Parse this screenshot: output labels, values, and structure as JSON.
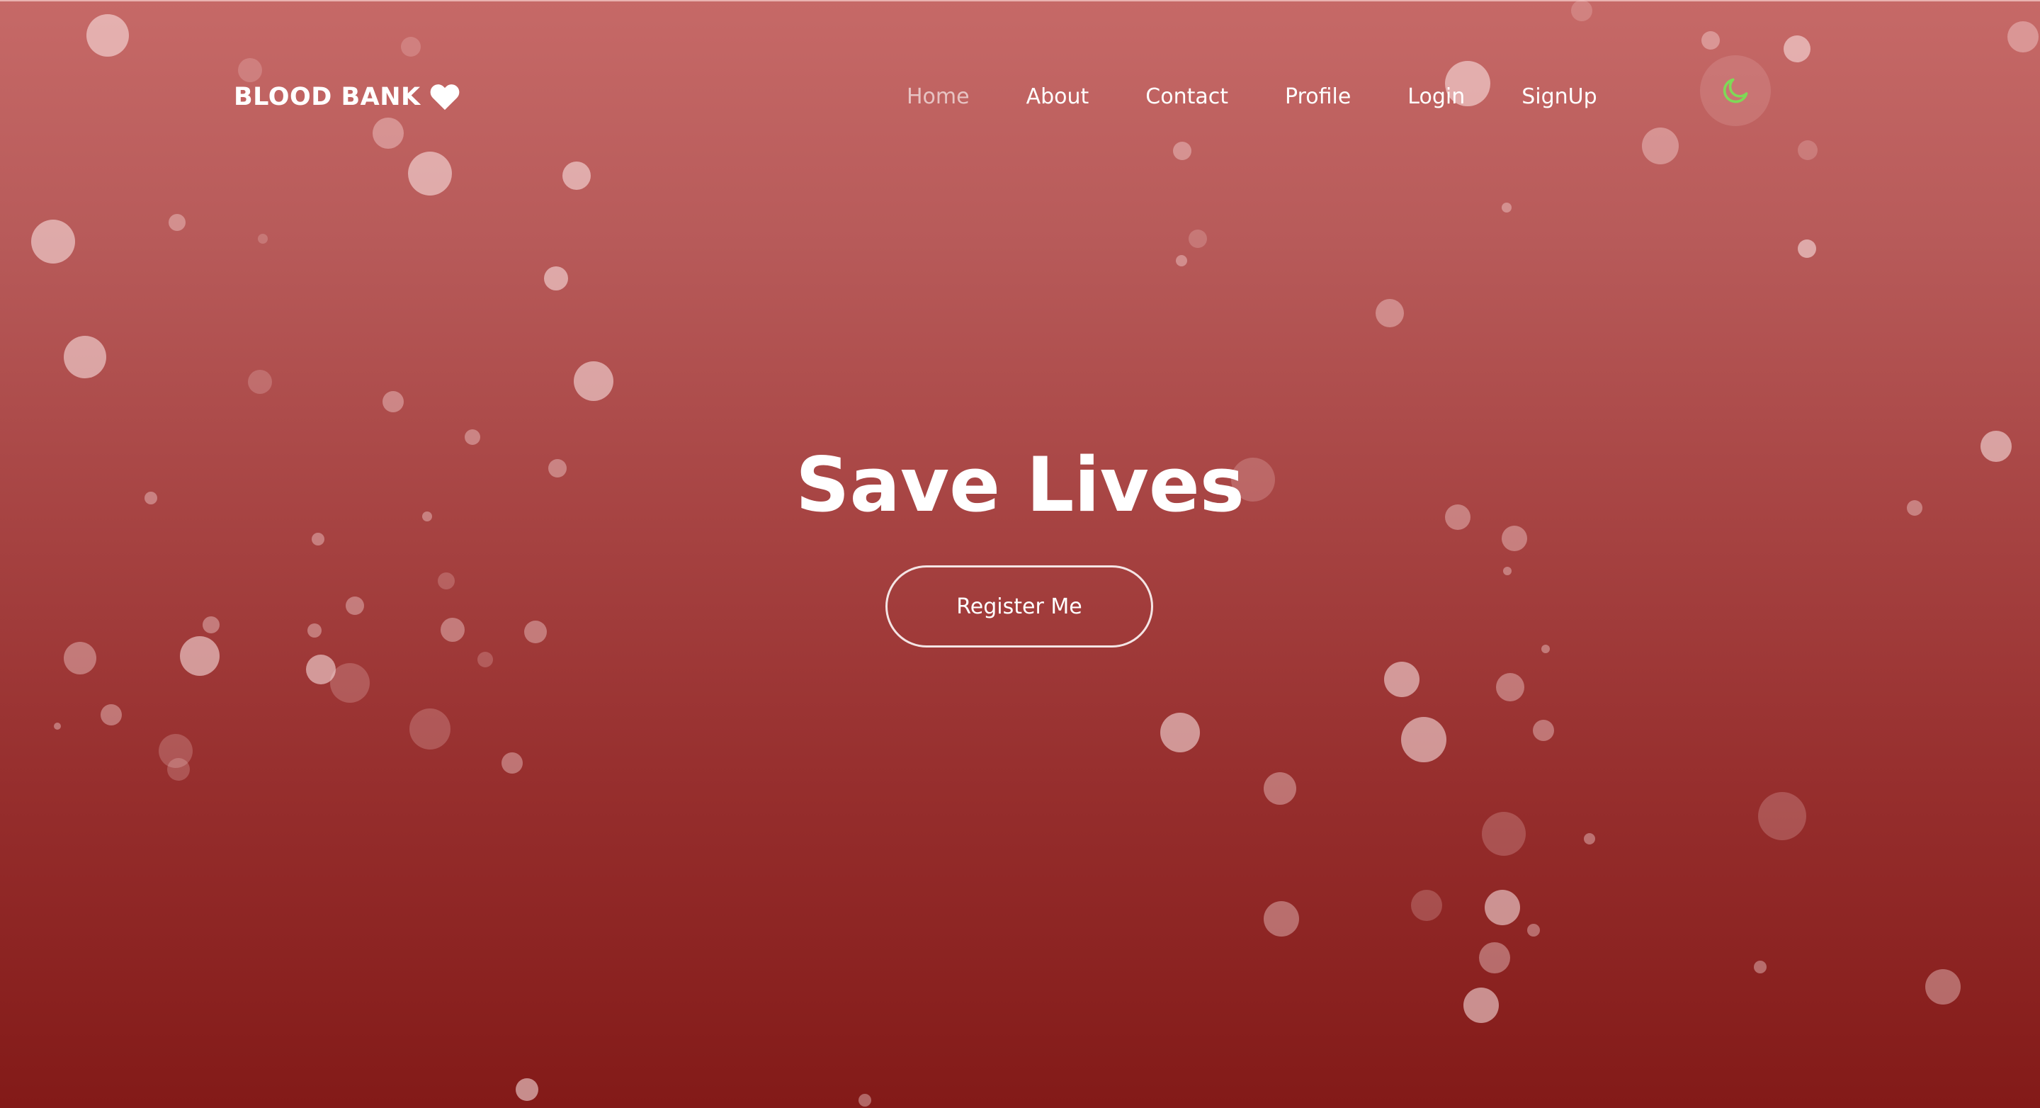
{
  "brand": {
    "name": "BLOOD BANK",
    "icon": "heart-icon"
  },
  "nav": {
    "items": [
      {
        "label": "Home",
        "active": true
      },
      {
        "label": "About",
        "active": false
      },
      {
        "label": "Contact",
        "active": false
      },
      {
        "label": "Profile",
        "active": false
      },
      {
        "label": "Login",
        "active": false
      },
      {
        "label": "SignUp",
        "active": false
      }
    ]
  },
  "theme_toggle": {
    "icon": "moon-icon",
    "icon_color": "#7ed957"
  },
  "hero": {
    "title": "Save Lives",
    "cta_label": "Register Me"
  },
  "colors": {
    "gradient_top": "#c66967",
    "gradient_bottom": "#831a18",
    "text": "#ffffff",
    "nav_active": "#e6b7b6"
  }
}
